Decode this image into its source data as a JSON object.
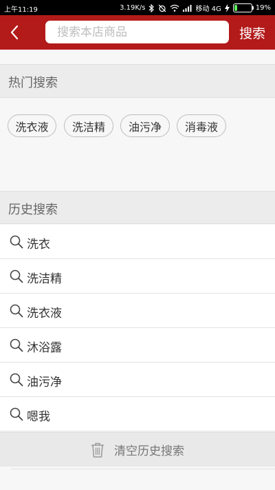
{
  "status_bar": {
    "time": "上午11:19",
    "net_speed": "3.19K/s",
    "carrier": "移动 4G",
    "battery_percent": "19%",
    "battery_level": 0.19,
    "battery_color": "#5ef060"
  },
  "header": {
    "back_icon": "chevron-left-icon",
    "search_placeholder": "搜索本店商品",
    "search_value": "",
    "search_button_label": "搜索",
    "bar_color": "#b31a1a"
  },
  "hot_search": {
    "title": "热门搜索",
    "tags": [
      "洗衣液",
      "洗洁精",
      "油污净",
      "消毒液"
    ]
  },
  "history": {
    "title": "历史搜索",
    "item_icon": "search-icon",
    "items": [
      "洗衣",
      "洗洁精",
      "洗衣液",
      "沐浴露",
      "油污净",
      "嗯我"
    ]
  },
  "clear_history": {
    "icon": "trash-icon",
    "label": "清空历史搜索"
  }
}
